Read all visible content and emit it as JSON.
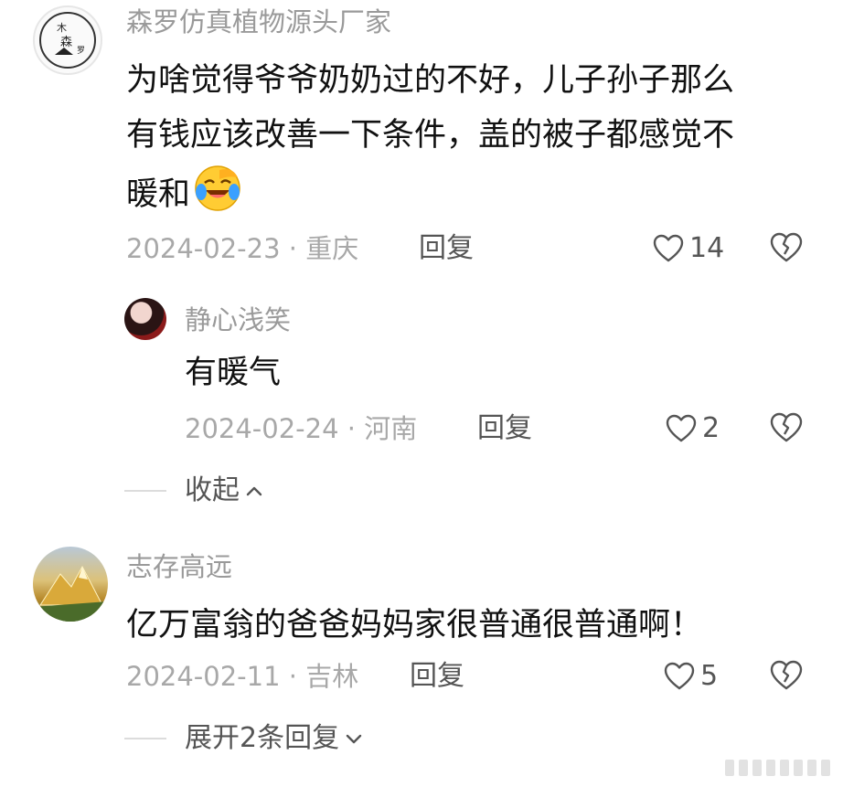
{
  "comments": [
    {
      "username": "森罗仿真植物源头厂家",
      "text_lines": [
        "为啥觉得爷爷奶奶过的不好，儿子孙子那么",
        "有钱应该改善一下条件，盖的被子都感觉不",
        "暖和"
      ],
      "emoji": "crying-laughing-emoji",
      "date_location": "2024-02-23 · 重庆",
      "reply_label": "回复",
      "likes": "14",
      "avatar": {
        "chars": [
          "木",
          "森",
          "罗"
        ]
      }
    },
    {
      "username": "静心浅笑",
      "text": "有暖气",
      "date_location": "2024-02-24 · 河南",
      "reply_label": "回复",
      "likes": "2"
    },
    {
      "username": "志存高远",
      "text": "亿万富翁的爸爸妈妈家很普通很普通啊！",
      "date_location": "2024-02-11 · 吉林",
      "reply_label": "回复",
      "likes": "5"
    }
  ],
  "collapse_label": "收起",
  "expand_label": "展开2条回复",
  "colors": {
    "username": "#9a9a9a",
    "body": "#111111",
    "meta": "#a8a8a8",
    "action": "#555555"
  }
}
